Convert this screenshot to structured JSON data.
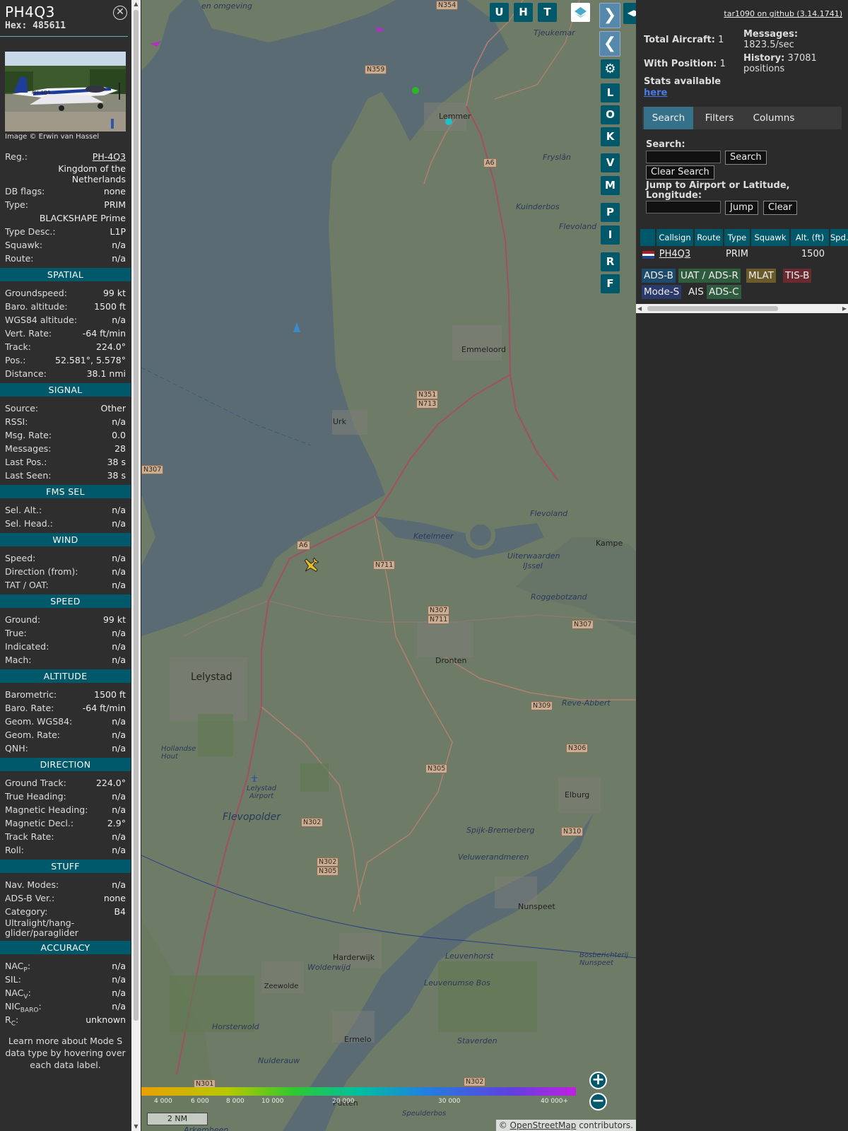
{
  "info": {
    "callsign": "PH4Q3",
    "hex_label": "Hex:",
    "hex": "485611",
    "image_credit": "Image © Erwin van Hassel",
    "photo_reg": "PH-4Q3",
    "reg_label": "Reg.:",
    "reg": "PH-4Q3",
    "country": "Kingdom of the Netherlands",
    "dbflags_label": "DB flags:",
    "dbflags": "none",
    "type_label": "Type:",
    "type": "PRIM",
    "model": "BLACKSHAPE Prime",
    "typedesc_label": "Type Desc.:",
    "typedesc": "L1P",
    "squawk_label": "Squawk:",
    "squawk": "n/a",
    "route_label": "Route:",
    "route": "n/a",
    "spatial": {
      "title": "SPATIAL",
      "rows": [
        {
          "k": "Groundspeed:",
          "v": "99 kt"
        },
        {
          "k": "Baro. altitude:",
          "v": "1500 ft"
        },
        {
          "k": "WGS84 altitude:",
          "v": "n/a"
        },
        {
          "k": "Vert. Rate:",
          "v": "-64 ft/min"
        },
        {
          "k": "Track:",
          "v": "224.0°"
        },
        {
          "k": "Pos.:",
          "v": "52.581°, 5.578°"
        },
        {
          "k": "Distance:",
          "v": "38.1 nmi"
        }
      ]
    },
    "signal": {
      "title": "SIGNAL",
      "rows": [
        {
          "k": "Source:",
          "v": "Other"
        },
        {
          "k": "RSSI:",
          "v": "n/a"
        },
        {
          "k": "Msg. Rate:",
          "v": "0.0"
        },
        {
          "k": "Messages:",
          "v": "28"
        },
        {
          "k": "Last Pos.:",
          "v": "38 s"
        },
        {
          "k": "Last Seen:",
          "v": "38 s"
        }
      ]
    },
    "fms": {
      "title": "FMS SEL",
      "rows": [
        {
          "k": "Sel. Alt.:",
          "v": "n/a"
        },
        {
          "k": "Sel. Head.:",
          "v": "n/a"
        }
      ]
    },
    "wind": {
      "title": "WIND",
      "rows": [
        {
          "k": "Speed:",
          "v": "n/a"
        },
        {
          "k": "Direction (from):",
          "v": "n/a"
        },
        {
          "k": "TAT / OAT:",
          "v": "n/a"
        }
      ]
    },
    "speed": {
      "title": "SPEED",
      "rows": [
        {
          "k": "Ground:",
          "v": "99 kt"
        },
        {
          "k": "True:",
          "v": "n/a"
        },
        {
          "k": "Indicated:",
          "v": "n/a"
        },
        {
          "k": "Mach:",
          "v": "n/a"
        }
      ]
    },
    "altitude": {
      "title": "ALTITUDE",
      "rows": [
        {
          "k": "Barometric:",
          "v": "1500 ft"
        },
        {
          "k": "Baro. Rate:",
          "v": "-64 ft/min"
        },
        {
          "k": "Geom. WGS84:",
          "v": "n/a"
        },
        {
          "k": "Geom. Rate:",
          "v": "n/a"
        },
        {
          "k": "QNH:",
          "v": "n/a"
        }
      ]
    },
    "direction": {
      "title": "DIRECTION",
      "rows": [
        {
          "k": "Ground Track:",
          "v": "224.0°"
        },
        {
          "k": "True Heading:",
          "v": "n/a"
        },
        {
          "k": "Magnetic Heading:",
          "v": "n/a"
        },
        {
          "k": "Magnetic Decl.:",
          "v": "2.9°"
        },
        {
          "k": "Track Rate:",
          "v": "n/a"
        },
        {
          "k": "Roll:",
          "v": "n/a"
        }
      ]
    },
    "stuff": {
      "title": "STUFF",
      "rows": [
        {
          "k": "Nav. Modes:",
          "v": "n/a"
        },
        {
          "k": "ADS-B Ver.:",
          "v": "none"
        },
        {
          "k": "Category:",
          "v": "B4"
        }
      ],
      "category_desc": "Ultralight/hang-glider/paraglider"
    },
    "accuracy": {
      "title": "ACCURACY",
      "rows": [
        {
          "k": "NAC",
          "sub": "P",
          "v": "n/a"
        },
        {
          "k": "SIL:",
          "sub": "",
          "v": "n/a"
        },
        {
          "k": "NAC",
          "sub": "V",
          "v": "n/a"
        },
        {
          "k": "NIC",
          "sub": "BARO",
          "v": "n/a"
        },
        {
          "k": "R",
          "sub": "C",
          "v": "unknown"
        }
      ]
    },
    "learn_more": "Learn more about Mode S data type by hovering over each data label."
  },
  "map": {
    "buttons": [
      "U",
      "H",
      "T"
    ],
    "side_buttons": [
      "L",
      "O",
      "K",
      "V",
      "M",
      "P",
      "I",
      "R",
      "F"
    ],
    "places": [
      {
        "name": "en omgeving",
        "italic": true
      },
      {
        "name": "Tjeukemar",
        "italic": true
      },
      {
        "name": "Lemmer"
      },
      {
        "name": "Fryslân",
        "italic": true
      },
      {
        "name": "Kuinderbos",
        "italic": true
      },
      {
        "name": "Flevoland",
        "italic": true
      },
      {
        "name": "Emmeloord"
      },
      {
        "name": "Urk"
      },
      {
        "name": "Flevoland",
        "italic": true
      },
      {
        "name": "Ketelmeer",
        "italic": true
      },
      {
        "name": "Uiterwaarden",
        "italic": true
      },
      {
        "name": "IJssel",
        "italic": true
      },
      {
        "name": "Kampe"
      },
      {
        "name": "Roggebotzand",
        "italic": true
      },
      {
        "name": "Dronten"
      },
      {
        "name": "Lelystad",
        "big": true
      },
      {
        "name": "Reve-Abbert",
        "italic": true
      },
      {
        "name": "Hollandse Hout",
        "italic": true
      },
      {
        "name": "Lelystad Airport",
        "italic": true
      },
      {
        "name": "Flevopolder",
        "big": true,
        "italic": true
      },
      {
        "name": "Elburg"
      },
      {
        "name": "Spijk-Bremerberg",
        "italic": true
      },
      {
        "name": "Veluwerandmeren",
        "italic": true
      },
      {
        "name": "Nunspeet"
      },
      {
        "name": "Harderwijk"
      },
      {
        "name": "Zeewolde"
      },
      {
        "name": "Leuvenhorst",
        "italic": true
      },
      {
        "name": "Leuvenumse Bos",
        "italic": true
      },
      {
        "name": "Horsterwold",
        "italic": true
      },
      {
        "name": "Ermelo"
      },
      {
        "name": "Staverden",
        "italic": true
      },
      {
        "name": "Nulderauw",
        "italic": true
      },
      {
        "name": "Putten"
      },
      {
        "name": "Speulderbos",
        "italic": true
      },
      {
        "name": "Wolderwijd",
        "italic": true
      },
      {
        "name": "Bosberichterij Nunspeet",
        "italic": true
      },
      {
        "name": "Arkemheen",
        "italic": true
      }
    ],
    "roads": [
      "N354",
      "N359",
      "A6",
      "N351",
      "N713",
      "N307",
      "A6",
      "N711",
      "N307",
      "N711",
      "N307",
      "N309",
      "N306",
      "N305",
      "N302",
      "N302",
      "N305",
      "N310",
      "N301",
      "N302"
    ],
    "color_scale": [
      "4 000",
      "6 000",
      "8 000",
      "10 000",
      "20 000",
      "30 000",
      "40 000+"
    ],
    "scale_bar": "2 NM",
    "attribution_prefix": "© ",
    "attribution_link": "OpenStreetMap",
    "attribution_suffix": " contributors."
  },
  "panel": {
    "github": "tar1090 on github (3.14.1741)",
    "total_label": "Total Aircraft:",
    "total": "1",
    "withpos_label": "With Position:",
    "withpos": "1",
    "stats_label": "Stats available",
    "stats_link": "here",
    "messages_label": "Messages:",
    "messages": "1823.5/sec",
    "history_label": "History:",
    "history": "37081 positions",
    "tabs": [
      "Search",
      "Filters",
      "Columns"
    ],
    "search_label": "Search:",
    "search_button": "Search",
    "clear_search": "Clear Search",
    "jump_label": "Jump to Airport or Latitude, Longitude:",
    "jump_button": "Jump",
    "clear_button": "Clear",
    "table": {
      "headers": [
        "Callsign",
        "Route",
        "Type",
        "Squawk",
        "Alt. (ft)",
        "Spd."
      ],
      "row": {
        "callsign": "PH4Q3",
        "route": "",
        "type": "PRIM",
        "squawk": "",
        "alt": "1500",
        "spd": ""
      }
    },
    "badges": [
      {
        "label": "ADS-B",
        "bg": "#1e4a6b"
      },
      {
        "label": "UAT / ADS-R",
        "bg": "#2f5b3e"
      },
      {
        "label": "MLAT",
        "bg": "#6b5b2a"
      },
      {
        "label": "TIS-B",
        "bg": "#6b2a2f"
      },
      {
        "label": "Mode-S",
        "bg": "#2a3b6b"
      },
      {
        "label": "AIS",
        "bg": ""
      },
      {
        "label": "ADS-C",
        "bg": "#2f5b3e"
      }
    ]
  }
}
